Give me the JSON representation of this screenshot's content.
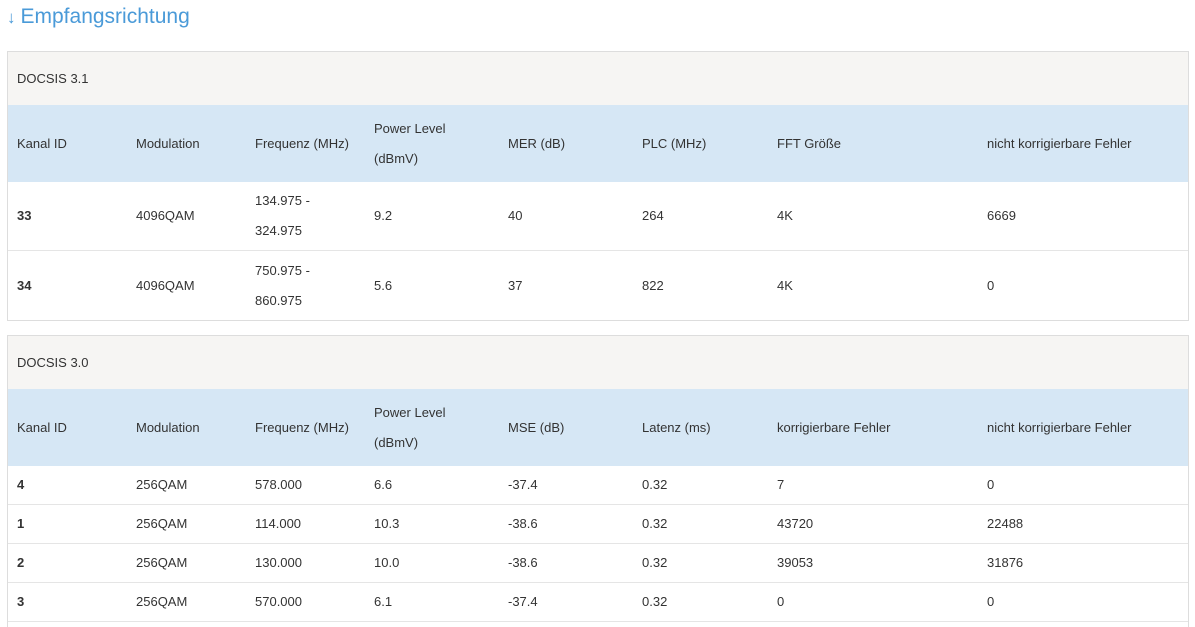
{
  "heading": {
    "arrow": "↓",
    "title": "Empfangsrichtung"
  },
  "docsis31": {
    "title": "DOCSIS 3.1",
    "columns": [
      "Kanal ID",
      "Modulation",
      "Frequenz (MHz)",
      "Power Level (dBmV)",
      "MER (dB)",
      "PLC (MHz)",
      "FFT Größe",
      "nicht korrigierbare Fehler"
    ],
    "power_level_line1": "Power Level",
    "power_level_line2": "(dBmV)",
    "rows": [
      {
        "kanal_id": "33",
        "modulation": "4096QAM",
        "frequenz_line1": "134.975 -",
        "frequenz_line2": "324.975",
        "power_level": "9.2",
        "mer": "40",
        "plc": "264",
        "fft": "4K",
        "nicht_korrigierbar": "6669"
      },
      {
        "kanal_id": "34",
        "modulation": "4096QAM",
        "frequenz_line1": "750.975 -",
        "frequenz_line2": "860.975",
        "power_level": "5.6",
        "mer": "37",
        "plc": "822",
        "fft": "4K",
        "nicht_korrigierbar": "0"
      }
    ]
  },
  "docsis30": {
    "title": "DOCSIS 3.0",
    "columns": [
      "Kanal ID",
      "Modulation",
      "Frequenz (MHz)",
      "Power Level (dBmV)",
      "MSE (dB)",
      "Latenz (ms)",
      "korrigierbare Fehler",
      "nicht korrigierbare Fehler"
    ],
    "power_level_line1": "Power Level",
    "power_level_line2": "(dBmV)",
    "rows": [
      {
        "kanal_id": "4",
        "modulation": "256QAM",
        "frequenz": "578.000",
        "power_level": "6.6",
        "mse": "-37.4",
        "latenz": "0.32",
        "korrigierbar": "7",
        "nicht_korrigierbar": "0"
      },
      {
        "kanal_id": "1",
        "modulation": "256QAM",
        "frequenz": "114.000",
        "power_level": "10.3",
        "mse": "-38.6",
        "latenz": "0.32",
        "korrigierbar": "43720",
        "nicht_korrigierbar": "22488"
      },
      {
        "kanal_id": "2",
        "modulation": "256QAM",
        "frequenz": "130.000",
        "power_level": "10.0",
        "mse": "-38.6",
        "latenz": "0.32",
        "korrigierbar": "39053",
        "nicht_korrigierbar": "31876"
      },
      {
        "kanal_id": "3",
        "modulation": "256QAM",
        "frequenz": "570.000",
        "power_level": "6.1",
        "mse": "-37.4",
        "latenz": "0.32",
        "korrigierbar": "0",
        "nicht_korrigierbar": "0"
      }
    ]
  },
  "colors": {
    "heading": "#4a9ad8",
    "panel_title_bg": "#f6f5f3",
    "header_bg": "#d6e7f5",
    "border": "#dddddd"
  }
}
